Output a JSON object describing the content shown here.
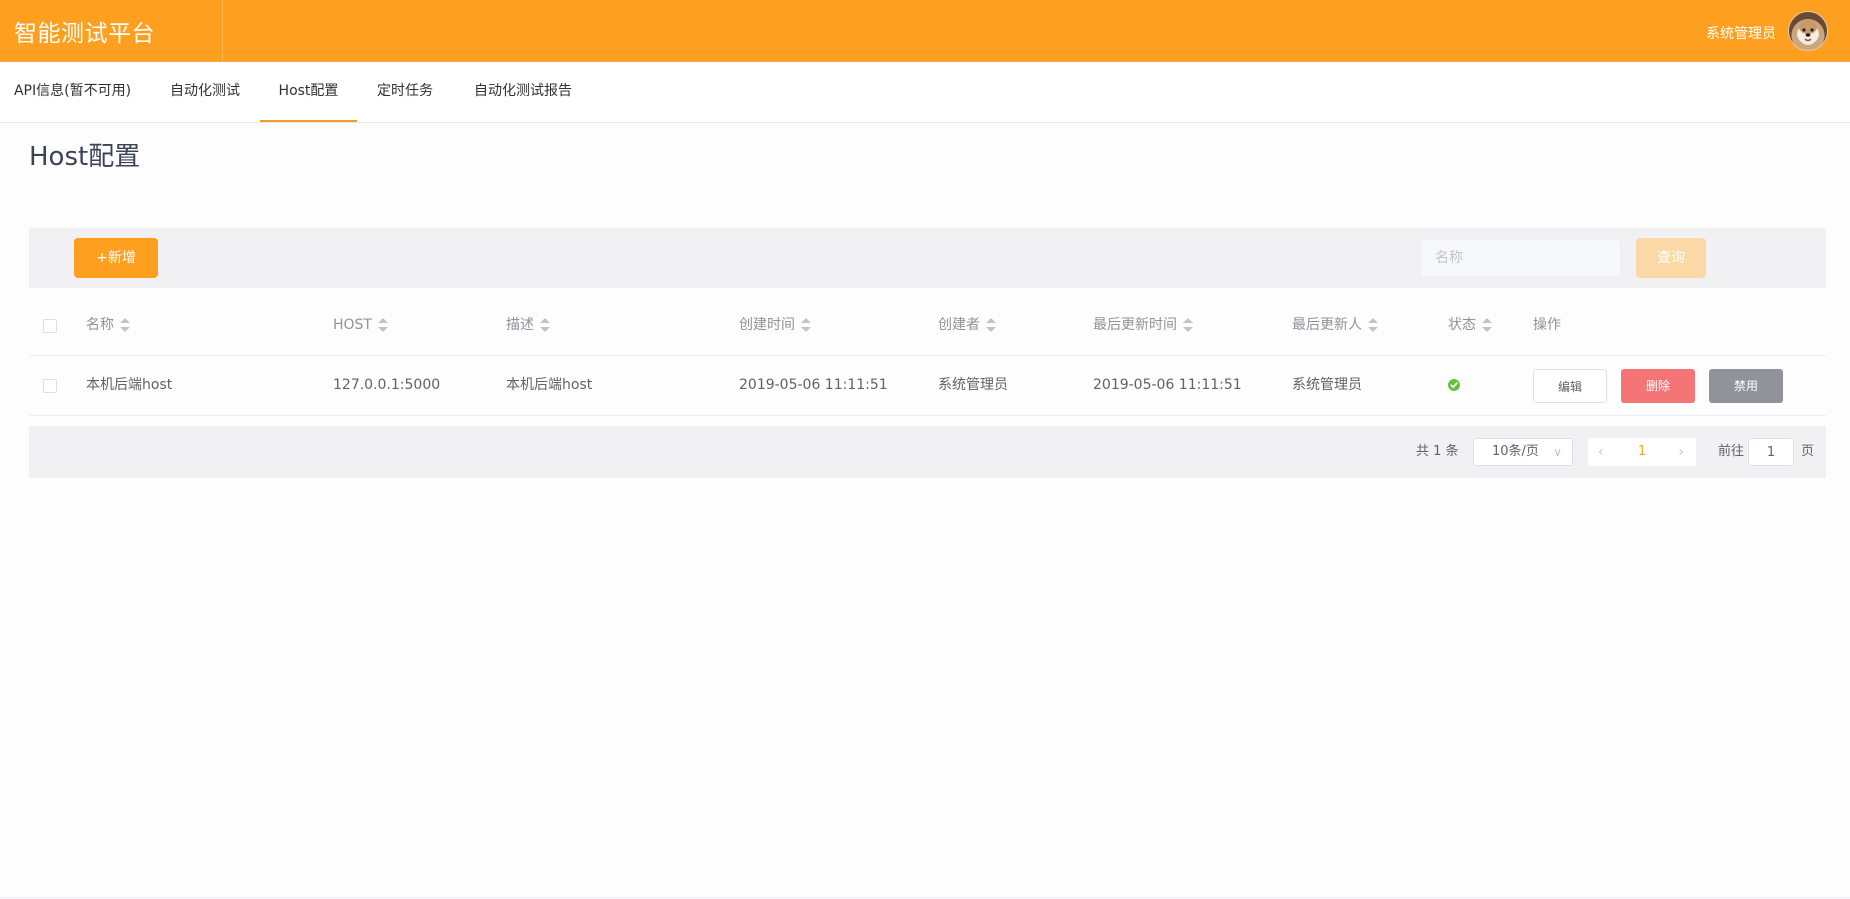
{
  "header": {
    "brand": "智能测试平台",
    "user_name": "系统管理员",
    "accent_color": "#ff9f1f"
  },
  "tabs": [
    {
      "label": "API信息(暂不可用)",
      "active": false
    },
    {
      "label": "自动化测试",
      "active": false
    },
    {
      "label": "Host配置",
      "active": true
    },
    {
      "label": "定时任务",
      "active": false
    },
    {
      "label": "自动化测试报告",
      "active": false
    }
  ],
  "page": {
    "title": "Host配置"
  },
  "toolbar": {
    "add_label": "+新增",
    "search_placeholder": "名称",
    "search_value": "",
    "query_label": "查询"
  },
  "table": {
    "columns": [
      "名称",
      "HOST",
      "描述",
      "创建时间",
      "创建者",
      "最后更新时间",
      "最后更新人",
      "状态",
      "操作"
    ],
    "rows": [
      {
        "name": "本机后端host",
        "host": "127.0.0.1:5000",
        "description": "本机后端host",
        "created_at": "2019-05-06 11:11:51",
        "creator": "系统管理员",
        "updated_at": "2019-05-06 11:11:51",
        "updater": "系统管理员",
        "status": "enabled",
        "status_icon": "check-circle-icon",
        "actions": {
          "edit": "编辑",
          "delete": "删除",
          "disable": "禁用"
        }
      }
    ]
  },
  "pagination": {
    "total_label": "共 1 条",
    "page_size": "10条/页",
    "current_page": "1",
    "goto_label": "前往",
    "goto_value": "1",
    "page_suffix": "页"
  }
}
